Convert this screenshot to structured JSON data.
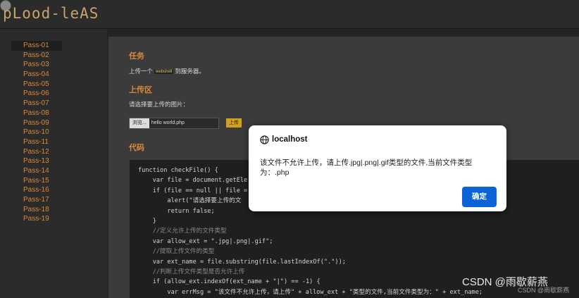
{
  "header": {
    "logo": "pLood-leAS"
  },
  "sidebar": {
    "items": [
      "Pass-01",
      "Pass-02",
      "Pass-03",
      "Pass-04",
      "Pass-05",
      "Pass-06",
      "Pass-07",
      "Pass-08",
      "Pass-09",
      "Pass-10",
      "Pass-11",
      "Pass-12",
      "Pass-13",
      "Pass-14",
      "Pass-15",
      "Pass-16",
      "Pass-17",
      "Pass-18",
      "Pass-19"
    ]
  },
  "main": {
    "task_title": "任务",
    "task_text_before": "上传一个",
    "task_code": "webshell",
    "task_text_after": "到服务器。",
    "upload_title": "上传区",
    "upload_hint": "请选择要上传的图片：",
    "browse_label": "浏览...",
    "file_name": "hello world.php",
    "upload_button": "上传",
    "code_title": "代码",
    "code_lines": [
      "function checkFile() {",
      "    var file = document.getEle",
      "    if (file == null || file =",
      "        alert(\"请选择要上传的文",
      "        return false;",
      "    }",
      "    //定义允许上传的文件类型",
      "    var allow_ext = \".jpg|.png|.gif\";",
      "    //提取上传文件的类型",
      "    var ext_name = file.substring(file.lastIndexOf(\".\"));",
      "    //判断上传文件类型是否允许上传",
      "    if (allow_ext.indexOf(ext_name + \"|\") == -1) {",
      "        var errMsg = \"该文件不允许上传，请上传\" + allow_ext + \"类型的文件,当前文件类型为：\" + ext_name;"
    ]
  },
  "dialog": {
    "title": "localhost",
    "message": "该文件不允许上传，请上传.jpg|.png|.gif类型的文件,当前文件类型为：.php",
    "ok_label": "确定"
  },
  "watermark": {
    "main": "CSDN @雨歇薪燕",
    "small": "CSDN @雨歇薪燕"
  }
}
